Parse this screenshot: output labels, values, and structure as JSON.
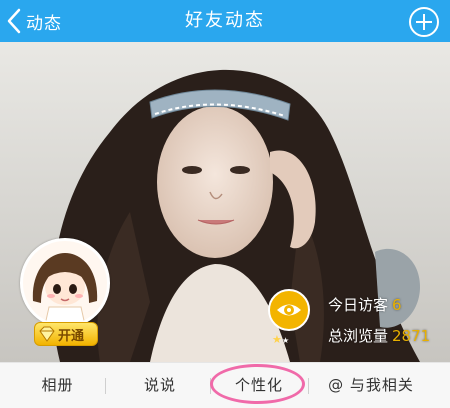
{
  "header": {
    "back_label": "动态",
    "title": "好友动态",
    "back_icon": "chevron-left-icon",
    "add_icon": "plus-circle-icon",
    "background": "#2aa7ee"
  },
  "profile": {
    "vip_label": "开通",
    "visitor_today_label": "今日访客",
    "visitor_today_value": "6",
    "total_views_label": "总浏览量",
    "total_views_value": "2871",
    "eye_icon": "eye-icon"
  },
  "tabs": [
    {
      "label": "相册"
    },
    {
      "label": "说说"
    },
    {
      "label": "个性化"
    },
    {
      "label": "@ 与我相关"
    }
  ],
  "highlight_color": "#f06aa9",
  "accent_color": "#f3b400"
}
